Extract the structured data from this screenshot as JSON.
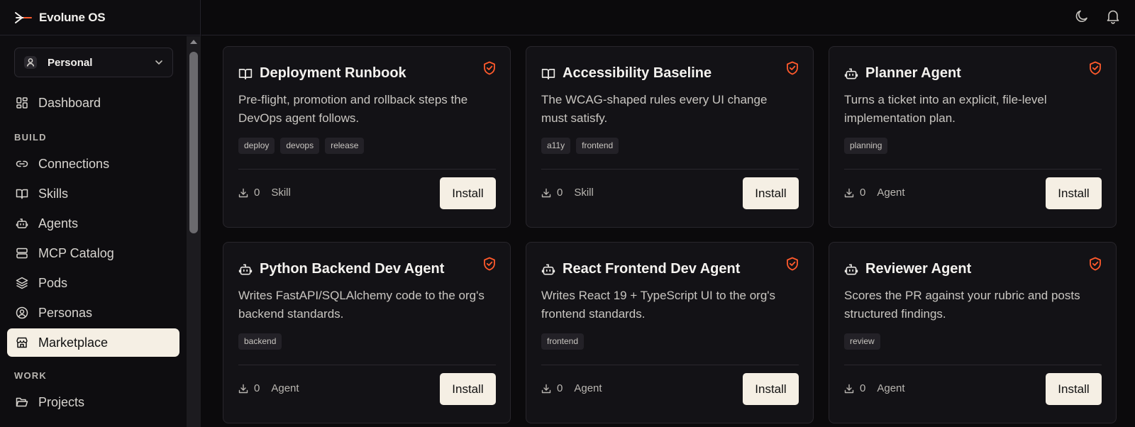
{
  "app": {
    "name": "Evolune OS"
  },
  "workspace": {
    "label": "Personal"
  },
  "nav": {
    "dashboard": "Dashboard",
    "build_section": "BUILD",
    "build_items": [
      "Connections",
      "Skills",
      "Agents",
      "MCP Catalog",
      "Pods",
      "Personas",
      "Marketplace"
    ],
    "work_section": "WORK",
    "work_items": [
      "Projects"
    ],
    "active": "Marketplace"
  },
  "colors": {
    "accent": "#ff5a2c",
    "active_bg": "#f5efe4",
    "background": "#0b0a0c",
    "card": "#131216"
  },
  "cards": [
    {
      "title": "Deployment Runbook",
      "icon": "book-icon",
      "description": "Pre-flight, promotion and rollback steps the DevOps agent follows.",
      "tags": [
        "deploy",
        "devops",
        "release"
      ],
      "installs": "0",
      "type": "Skill",
      "button": "Install"
    },
    {
      "title": "Accessibility Baseline",
      "icon": "book-icon",
      "description": "The WCAG-shaped rules every UI change must satisfy.",
      "tags": [
        "a11y",
        "frontend"
      ],
      "installs": "0",
      "type": "Skill",
      "button": "Install"
    },
    {
      "title": "Planner Agent",
      "icon": "bot-icon",
      "description": "Turns a ticket into an explicit, file-level implementation plan.",
      "tags": [
        "planning"
      ],
      "installs": "0",
      "type": "Agent",
      "button": "Install"
    },
    {
      "title": "Python Backend Dev Agent",
      "icon": "bot-icon",
      "description": "Writes FastAPI/SQLAlchemy code to the org's backend standards.",
      "tags": [
        "backend"
      ],
      "installs": "0",
      "type": "Agent",
      "button": "Install"
    },
    {
      "title": "React Frontend Dev Agent",
      "icon": "bot-icon",
      "description": "Writes React 19 + TypeScript UI to the org's frontend standards.",
      "tags": [
        "frontend"
      ],
      "installs": "0",
      "type": "Agent",
      "button": "Install"
    },
    {
      "title": "Reviewer Agent",
      "icon": "bot-icon",
      "description": "Scores the PR against your rubric and posts structured findings.",
      "tags": [
        "review"
      ],
      "installs": "0",
      "type": "Agent",
      "button": "Install"
    }
  ]
}
